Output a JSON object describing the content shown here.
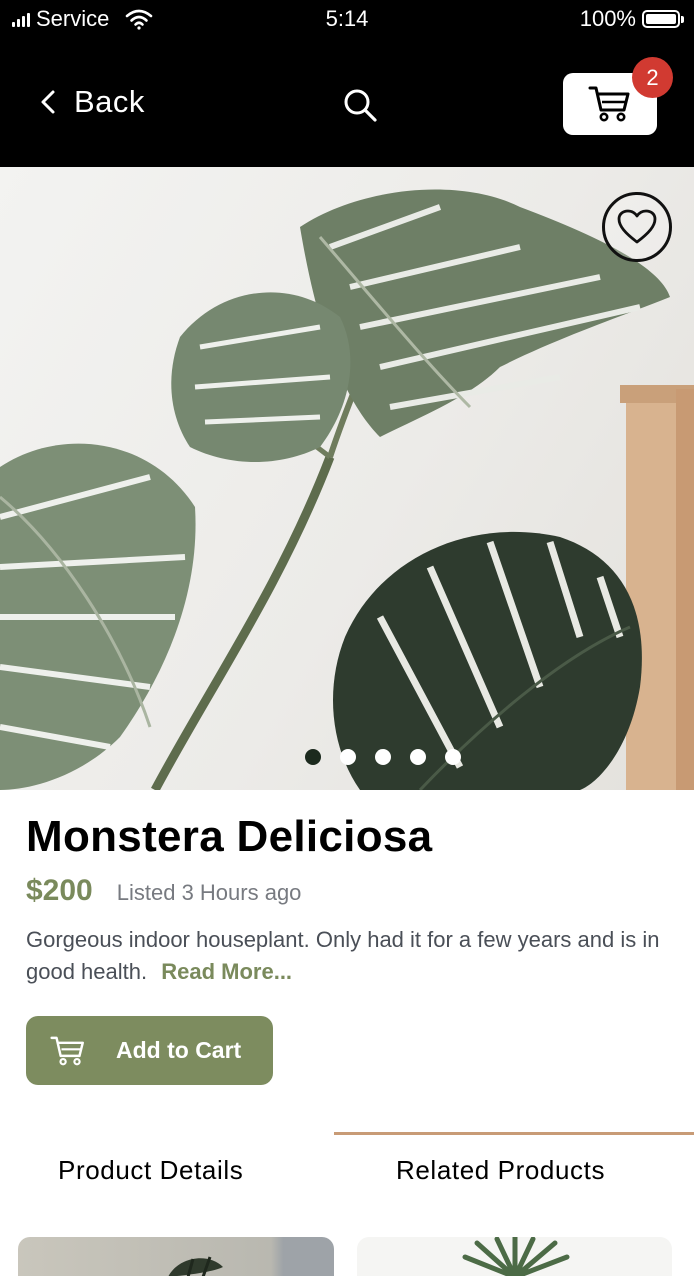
{
  "status_bar": {
    "carrier": "Service",
    "time": "5:14",
    "battery": "100%"
  },
  "nav": {
    "back_label": "Back",
    "cart_count": "2"
  },
  "carousel": {
    "total_slides": 5,
    "active_slide": 1
  },
  "product": {
    "title": "Monstera Deliciosa",
    "price": "$200",
    "listed": "Listed 3 Hours ago",
    "description": "Gorgeous indoor houseplant. Only had it for a few years and is in good health.",
    "read_more": "Read More...",
    "add_to_cart": "Add to Cart"
  },
  "tabs": [
    {
      "label": "Product Details",
      "active": false
    },
    {
      "label": "Related Products",
      "active": true
    }
  ],
  "colors": {
    "accent_green": "#7d8c5f",
    "badge_red": "#d13a31",
    "tab_indicator": "#c89b76"
  }
}
